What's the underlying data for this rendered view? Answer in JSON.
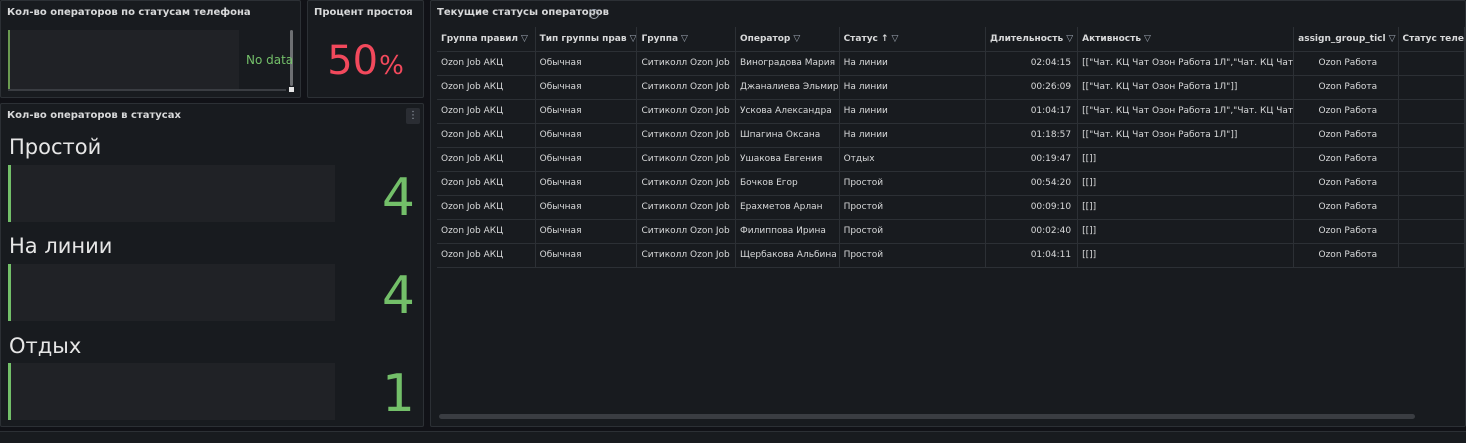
{
  "panels": {
    "phone": {
      "title": "Кол-во операторов по статусам телефона",
      "nodata": "No data"
    },
    "idle": {
      "title": "Процент простоя",
      "value": "50",
      "unit": "%"
    },
    "status": {
      "title": "Кол-во операторов в статусах",
      "menu_icon": "⋮",
      "stats": [
        {
          "label": "Простой",
          "value": "4"
        },
        {
          "label": "На линии",
          "value": "4"
        },
        {
          "label": "Отдых",
          "value": "1"
        }
      ]
    },
    "table": {
      "title": "Текущие статусы операторов",
      "info_icon": "i",
      "columns": [
        "Группа правил",
        "Тип группы прав",
        "Группа",
        "Оператор",
        "Статус",
        "Длительность",
        "Активность",
        "assign_group_ticl",
        "Статус теле"
      ],
      "sort_icon": "↑",
      "filter_icon": "▽",
      "rows": [
        [
          "Ozon Job АКЦ",
          "Обычная",
          "Ситиколл Ozon Job",
          "Виноградова Мария",
          "На линии",
          "02:04:15",
          "[[\"Чат. КЦ Чат Озон Работа 1Л\",\"Чат. КЦ Чат",
          "Ozon Работа",
          ""
        ],
        [
          "Ozon Job АКЦ",
          "Обычная",
          "Ситиколл Ozon Job",
          "Джаналиева Эльмир",
          "На линии",
          "00:26:09",
          "[[\"Чат. КЦ Чат Озон Работа 1Л\"]]",
          "Ozon Работа",
          ""
        ],
        [
          "Ozon Job АКЦ",
          "Обычная",
          "Ситиколл Ozon Job",
          "Ускова Александра",
          "На линии",
          "01:04:17",
          "[[\"Чат. КЦ Чат Озон Работа 1Л\",\"Чат. КЦ Чат",
          "Ozon Работа",
          ""
        ],
        [
          "Ozon Job АКЦ",
          "Обычная",
          "Ситиколл Ozon Job",
          "Шпагина Оксана",
          "На линии",
          "01:18:57",
          "[[\"Чат. КЦ Чат Озон Работа 1Л\"]]",
          "Ozon Работа",
          ""
        ],
        [
          "Ozon Job АКЦ",
          "Обычная",
          "Ситиколл Ozon Job",
          "Ушакова Евгения",
          "Отдых",
          "00:19:47",
          "[[]]",
          "Ozon Работа",
          ""
        ],
        [
          "Ozon Job АКЦ",
          "Обычная",
          "Ситиколл Ozon Job",
          "Бочков Егор",
          "Простой",
          "00:54:20",
          "[[]]",
          "Ozon Работа",
          ""
        ],
        [
          "Ozon Job АКЦ",
          "Обычная",
          "Ситиколл Ozon Job",
          "Ерахметов Арлан",
          "Простой",
          "00:09:10",
          "[[]]",
          "Ozon Работа",
          ""
        ],
        [
          "Ozon Job АКЦ",
          "Обычная",
          "Ситиколл Ozon Job",
          "Филиппова Ирина",
          "Простой",
          "00:02:40",
          "[[]]",
          "Ozon Работа",
          ""
        ],
        [
          "Ozon Job АКЦ",
          "Обычная",
          "Ситиколл Ozon Job",
          "Щербакова Альбина",
          "Простой",
          "01:04:11",
          "[[]]",
          "Ozon Работа",
          ""
        ]
      ]
    }
  },
  "colors": {
    "accent_green": "#73bf69",
    "accent_red": "#f2495c",
    "bg": "#111217",
    "panel": "#181b1f"
  }
}
